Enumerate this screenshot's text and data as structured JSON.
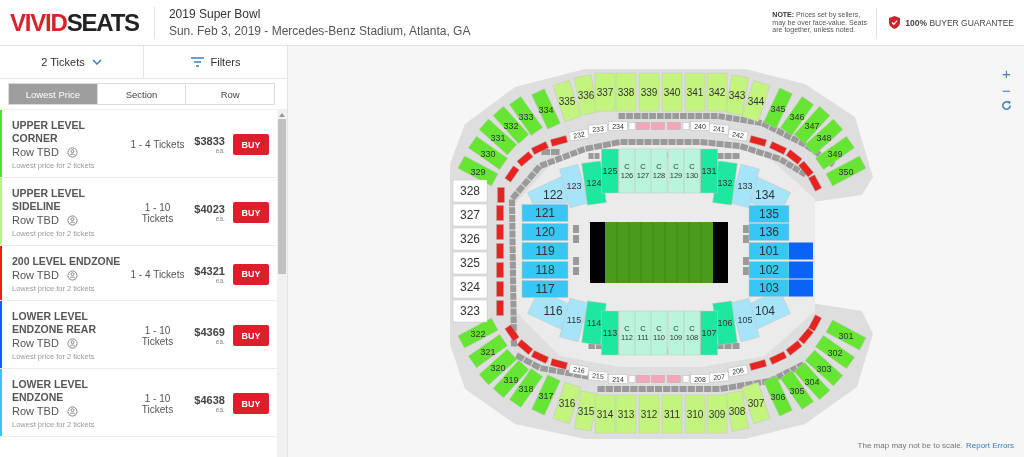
{
  "header": {
    "logo": {
      "part_1": "VIVID",
      "part_2": "SEATS"
    },
    "event_title": "2019 Super Bowl",
    "event_details": "Sun. Feb 3, 2019 - Mercedes-Benz Stadium, Atlanta, GA",
    "note": "**NOTE:** Prices set by sellers, may be over face-value. Seats are together, unless noted.",
    "guarantee": "**100%** BUYER GUARANTEE"
  },
  "toolbar": {
    "tickets": "2 Tickets",
    "filters": "Filters"
  },
  "sort_tabs": [
    {
      "label": "Lowest Price",
      "selected": true
    },
    {
      "label": "Section",
      "selected": false
    },
    {
      "label": "Row",
      "selected": false
    }
  ],
  "listings": [
    {
      "name": "UPPER LEVEL CORNER",
      "row": "Row TBD",
      "note": "Lowest price for 2 tickets",
      "tickets": "1 - 4 Tickets",
      "price": "$3833",
      "unit": "ea.",
      "button": "BUY",
      "color": "#44e824"
    },
    {
      "name": "UPPER LEVEL SIDELINE",
      "row": "Row TBD",
      "note": "Lowest price for 2 tickets",
      "tickets": "1 - 10 Tickets",
      "price": "$4023",
      "unit": "ea.",
      "button": "BUY",
      "color": "#bdf47c"
    },
    {
      "name": "200 LEVEL ENDZONE",
      "row": "Row TBD",
      "note": "Lowest price for 2 tickets",
      "tickets": "1 - 4 Tickets",
      "price": "$4321",
      "unit": "ea.",
      "button": "BUY",
      "color": "#e8221f"
    },
    {
      "name": "LOWER LEVEL ENDZONE REAR",
      "row": "Row TBD",
      "note": "Lowest price for 2 tickets",
      "tickets": "1 - 10 Tickets",
      "price": "$4369",
      "unit": "ea.",
      "button": "BUY",
      "color": "#0b63f6"
    },
    {
      "name": "LOWER LEVEL ENDZONE",
      "row": "Row TBD",
      "note": "Lowest price for 2 tickets",
      "tickets": "1 - 10 Tickets",
      "price": "$4638",
      "unit": "ea.",
      "button": "BUY",
      "color": "#35c8f4"
    }
  ],
  "map": {
    "zoom_in": "+",
    "zoom_out": "−",
    "disclaimer": "The map may not be to scale.",
    "report_link": "Report Errors",
    "upper_sections": [
      {
        "label": "329",
        "color": "#66e532"
      },
      {
        "label": "330",
        "color": "#66e532"
      },
      {
        "label": "331",
        "color": "#66e532"
      },
      {
        "label": "332",
        "color": "#66e532"
      },
      {
        "label": "333",
        "color": "#66e532"
      },
      {
        "label": "334",
        "color": "#66e532"
      },
      {
        "label": "335",
        "color": "#c2f47e"
      },
      {
        "label": "336",
        "color": "#c2f47e"
      },
      {
        "label": "337",
        "color": "#c2f47e"
      },
      {
        "label": "338",
        "color": "#c2f47e"
      },
      {
        "label": "339",
        "color": "#c2f47e"
      },
      {
        "label": "340",
        "color": "#c2f47e"
      },
      {
        "label": "341",
        "color": "#c2f47e"
      },
      {
        "label": "342",
        "color": "#c2f47e"
      },
      {
        "label": "343",
        "color": "#c2f47e"
      },
      {
        "label": "344",
        "color": "#c2f47e"
      },
      {
        "label": "345",
        "color": "#66e532"
      },
      {
        "label": "346",
        "color": "#66e532"
      },
      {
        "label": "347",
        "color": "#66e532"
      },
      {
        "label": "348",
        "color": "#66e532"
      },
      {
        "label": "349",
        "color": "#66e532"
      },
      {
        "label": "350",
        "color": "#66e532"
      },
      {
        "label": "328",
        "color": "#ffffff"
      },
      {
        "label": "327",
        "color": "#ffffff"
      },
      {
        "label": "326",
        "color": "#ffffff"
      },
      {
        "label": "325",
        "color": "#ffffff"
      },
      {
        "label": "324",
        "color": "#ffffff"
      },
      {
        "label": "323",
        "color": "#ffffff"
      },
      {
        "label": "322",
        "color": "#66e532"
      },
      {
        "label": "321",
        "color": "#66e532"
      },
      {
        "label": "320",
        "color": "#66e532"
      },
      {
        "label": "319",
        "color": "#66e532"
      },
      {
        "label": "318",
        "color": "#66e532"
      },
      {
        "label": "317",
        "color": "#66e532"
      },
      {
        "label": "316",
        "color": "#c2f47e"
      },
      {
        "label": "315",
        "color": "#c2f47e"
      },
      {
        "label": "314",
        "color": "#c2f47e"
      },
      {
        "label": "313",
        "color": "#c2f47e"
      },
      {
        "label": "312",
        "color": "#c2f47e"
      },
      {
        "label": "311",
        "color": "#c2f47e"
      },
      {
        "label": "310",
        "color": "#c2f47e"
      },
      {
        "label": "309",
        "color": "#c2f47e"
      },
      {
        "label": "308",
        "color": "#c2f47e"
      },
      {
        "label": "307",
        "color": "#c2f47e"
      },
      {
        "label": "306",
        "color": "#66e532"
      },
      {
        "label": "305",
        "color": "#66e532"
      },
      {
        "label": "304",
        "color": "#66e532"
      },
      {
        "label": "303",
        "color": "#66e532"
      },
      {
        "label": "302",
        "color": "#66e532"
      },
      {
        "label": "301",
        "color": "#66e532"
      }
    ],
    "club_sections": [
      {
        "color": "#e8221f"
      },
      {
        "color": "#e8221f"
      },
      {
        "color": "#e8221f"
      },
      {
        "color": "#e8221f"
      },
      {
        "label": "232",
        "color": "#ffffff"
      },
      {
        "label": "233",
        "color": "#ffffff"
      },
      {
        "label": "234",
        "color": "#ffffff"
      },
      {
        "color": "#ffffff"
      },
      {
        "color": "#f4a6b8"
      },
      {
        "color": "#f4a6b8"
      },
      {
        "color": "#f4a6b8"
      },
      {
        "color": "#ffffff"
      },
      {
        "label": "240",
        "color": "#ffffff"
      },
      {
        "label": "241",
        "color": "#ffffff"
      },
      {
        "label": "242",
        "color": "#ffffff"
      },
      {
        "color": "#e8221f"
      },
      {
        "color": "#e8221f"
      },
      {
        "color": "#e8221f"
      },
      {
        "color": "#e8221f"
      },
      {
        "color": "#e8221f"
      },
      {
        "color": "#e8221f"
      },
      {
        "color": "#e8221f"
      },
      {
        "color": "#e8221f"
      },
      {
        "color": "#e8221f"
      },
      {
        "color": "#e8221f"
      },
      {
        "color": "#e8221f"
      },
      {
        "color": "#e8221f"
      },
      {
        "color": "#e8221f"
      },
      {
        "color": "#e8221f"
      },
      {
        "color": "#e8221f"
      },
      {
        "color": "#e8221f"
      },
      {
        "label": "216",
        "color": "#ffffff"
      },
      {
        "label": "215",
        "color": "#ffffff"
      },
      {
        "label": "214",
        "color": "#ffffff"
      },
      {
        "color": "#ffffff"
      },
      {
        "color": "#f4a6b8"
      },
      {
        "color": "#f4a6b8"
      },
      {
        "color": "#f4a6b8"
      },
      {
        "color": "#ffffff"
      },
      {
        "label": "208",
        "color": "#ffffff"
      },
      {
        "label": "207",
        "color": "#ffffff"
      },
      {
        "label": "206",
        "color": "#ffffff"
      },
      {
        "color": "#e8221f"
      },
      {
        "color": "#e8221f"
      },
      {
        "color": "#e8221f"
      },
      {
        "color": "#e8221f"
      },
      {
        "color": "#e8221f"
      }
    ],
    "lower_sections": [
      {
        "label": "122",
        "color": "#a6e4fa"
      },
      {
        "label": "123",
        "color": "#a6e4fa"
      },
      {
        "label": "124",
        "color": "#1ee8a0"
      },
      {
        "label": "125",
        "color": "#1ee8a0"
      },
      {
        "label": "C 126",
        "color": "#b9f5da"
      },
      {
        "label": "C 127",
        "color": "#b9f5da"
      },
      {
        "label": "C 128",
        "color": "#b9f5da"
      },
      {
        "label": "C 129",
        "color": "#b9f5da"
      },
      {
        "label": "C 130",
        "color": "#b9f5da"
      },
      {
        "label": "131",
        "color": "#1ee8a0"
      },
      {
        "label": "132",
        "color": "#1ee8a0"
      },
      {
        "label": "133",
        "color": "#a6e4fa"
      },
      {
        "label": "134",
        "color": "#a6e4fa"
      },
      {
        "label": "121",
        "color": "#38c6f4"
      },
      {
        "label": "135",
        "color": "#38c6f4"
      },
      {
        "label": "120",
        "color": "#38c6f4"
      },
      {
        "label": "136",
        "color": "#38c6f4"
      },
      {
        "label": "119",
        "color": "#38c6f4"
      },
      {
        "label": "101",
        "color": "#38c6f4"
      },
      {
        "label": "118",
        "color": "#38c6f4"
      },
      {
        "label": "102",
        "color": "#38c6f4"
      },
      {
        "label": "117",
        "color": "#38c6f4"
      },
      {
        "label": "103",
        "color": "#38c6f4"
      },
      {
        "label": "116",
        "color": "#a6e4fa"
      },
      {
        "label": "115",
        "color": "#a6e4fa"
      },
      {
        "label": "114",
        "color": "#1ee8a0"
      },
      {
        "label": "113",
        "color": "#1ee8a0"
      },
      {
        "label": "C 112",
        "color": "#b9f5da"
      },
      {
        "label": "C 111",
        "color": "#b9f5da"
      },
      {
        "label": "C 110",
        "color": "#b9f5da"
      },
      {
        "label": "C 109",
        "color": "#b9f5da"
      },
      {
        "label": "C 108",
        "color": "#b9f5da"
      },
      {
        "label": "107",
        "color": "#1ee8a0"
      },
      {
        "label": "106",
        "color": "#1ee8a0"
      },
      {
        "label": "105",
        "color": "#a6e4fa"
      },
      {
        "label": "104",
        "color": "#a6e4fa"
      }
    ],
    "floor_sections": [
      {
        "color": "#0b63f6"
      },
      {
        "color": "#0b63f6"
      },
      {
        "color": "#0b63f6"
      }
    ]
  }
}
